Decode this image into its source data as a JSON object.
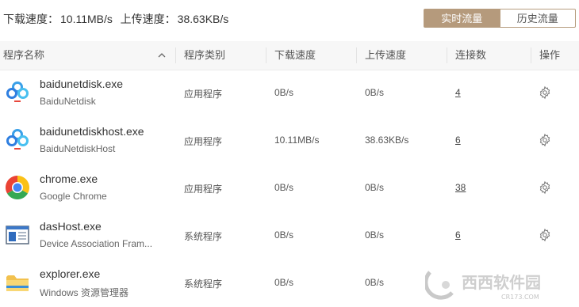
{
  "summary": {
    "download_label": "下载速度：",
    "download_value": "10.11MB/s",
    "upload_label": "上传速度：",
    "upload_value": "38.63KB/s"
  },
  "tabs": {
    "realtime": "实时流量",
    "history": "历史流量"
  },
  "columns": {
    "name": "程序名称",
    "type": "程序类别",
    "download": "下载速度",
    "upload": "上传速度",
    "connections": "连接数",
    "action": "操作"
  },
  "rows": [
    {
      "name": "baidunetdisk.exe",
      "desc": "BaiduNetdisk",
      "type": "应用程序",
      "download": "0B/s",
      "upload": "0B/s",
      "connections": "4",
      "icon": "baidu-netdisk-icon"
    },
    {
      "name": "baidunetdiskhost.exe",
      "desc": "BaiduNetdiskHost",
      "type": "应用程序",
      "download": "10.11MB/s",
      "upload": "38.63KB/s",
      "connections": "6",
      "icon": "baidu-netdisk-icon"
    },
    {
      "name": "chrome.exe",
      "desc": "Google Chrome",
      "type": "应用程序",
      "download": "0B/s",
      "upload": "0B/s",
      "connections": "38",
      "icon": "chrome-icon"
    },
    {
      "name": "dasHost.exe",
      "desc": "Device Association Fram...",
      "type": "系统程序",
      "download": "0B/s",
      "upload": "0B/s",
      "connections": "6",
      "icon": "window-icon"
    },
    {
      "name": "explorer.exe",
      "desc": "Windows 资源管理器",
      "type": "系统程序",
      "download": "0B/s",
      "upload": "0B/s",
      "connections": "",
      "icon": "folder-icon"
    }
  ],
  "watermark": {
    "text": "西西软件园",
    "sub": "CR173.COM"
  },
  "colors": {
    "accent": "#b59a7c",
    "header_bg": "#f7f7f7"
  }
}
